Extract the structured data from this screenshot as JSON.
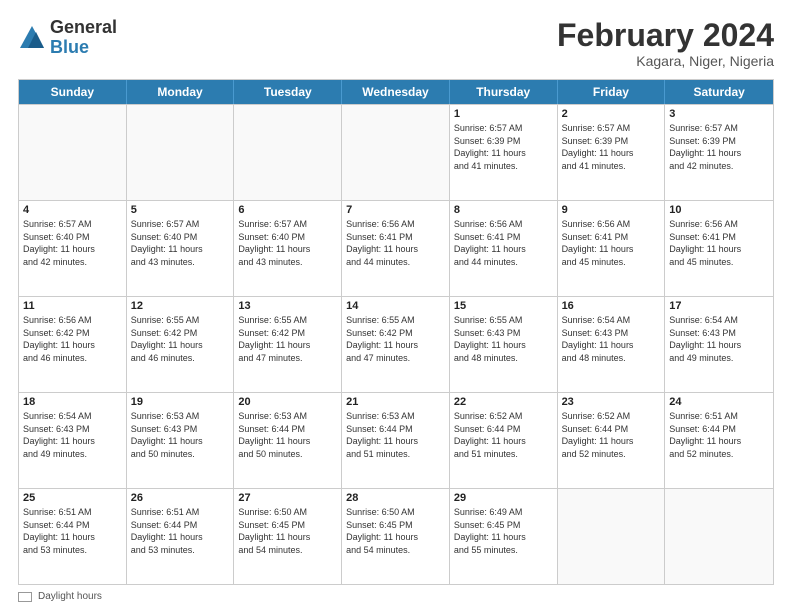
{
  "logo": {
    "general": "General",
    "blue": "Blue"
  },
  "header": {
    "month": "February 2024",
    "location": "Kagara, Niger, Nigeria"
  },
  "weekdays": [
    "Sunday",
    "Monday",
    "Tuesday",
    "Wednesday",
    "Thursday",
    "Friday",
    "Saturday"
  ],
  "footer": {
    "daylight_label": "Daylight hours"
  },
  "weeks": [
    [
      {
        "day": "",
        "info": ""
      },
      {
        "day": "",
        "info": ""
      },
      {
        "day": "",
        "info": ""
      },
      {
        "day": "",
        "info": ""
      },
      {
        "day": "1",
        "info": "Sunrise: 6:57 AM\nSunset: 6:39 PM\nDaylight: 11 hours\nand 41 minutes."
      },
      {
        "day": "2",
        "info": "Sunrise: 6:57 AM\nSunset: 6:39 PM\nDaylight: 11 hours\nand 41 minutes."
      },
      {
        "day": "3",
        "info": "Sunrise: 6:57 AM\nSunset: 6:39 PM\nDaylight: 11 hours\nand 42 minutes."
      }
    ],
    [
      {
        "day": "4",
        "info": "Sunrise: 6:57 AM\nSunset: 6:40 PM\nDaylight: 11 hours\nand 42 minutes."
      },
      {
        "day": "5",
        "info": "Sunrise: 6:57 AM\nSunset: 6:40 PM\nDaylight: 11 hours\nand 43 minutes."
      },
      {
        "day": "6",
        "info": "Sunrise: 6:57 AM\nSunset: 6:40 PM\nDaylight: 11 hours\nand 43 minutes."
      },
      {
        "day": "7",
        "info": "Sunrise: 6:56 AM\nSunset: 6:41 PM\nDaylight: 11 hours\nand 44 minutes."
      },
      {
        "day": "8",
        "info": "Sunrise: 6:56 AM\nSunset: 6:41 PM\nDaylight: 11 hours\nand 44 minutes."
      },
      {
        "day": "9",
        "info": "Sunrise: 6:56 AM\nSunset: 6:41 PM\nDaylight: 11 hours\nand 45 minutes."
      },
      {
        "day": "10",
        "info": "Sunrise: 6:56 AM\nSunset: 6:41 PM\nDaylight: 11 hours\nand 45 minutes."
      }
    ],
    [
      {
        "day": "11",
        "info": "Sunrise: 6:56 AM\nSunset: 6:42 PM\nDaylight: 11 hours\nand 46 minutes."
      },
      {
        "day": "12",
        "info": "Sunrise: 6:55 AM\nSunset: 6:42 PM\nDaylight: 11 hours\nand 46 minutes."
      },
      {
        "day": "13",
        "info": "Sunrise: 6:55 AM\nSunset: 6:42 PM\nDaylight: 11 hours\nand 47 minutes."
      },
      {
        "day": "14",
        "info": "Sunrise: 6:55 AM\nSunset: 6:42 PM\nDaylight: 11 hours\nand 47 minutes."
      },
      {
        "day": "15",
        "info": "Sunrise: 6:55 AM\nSunset: 6:43 PM\nDaylight: 11 hours\nand 48 minutes."
      },
      {
        "day": "16",
        "info": "Sunrise: 6:54 AM\nSunset: 6:43 PM\nDaylight: 11 hours\nand 48 minutes."
      },
      {
        "day": "17",
        "info": "Sunrise: 6:54 AM\nSunset: 6:43 PM\nDaylight: 11 hours\nand 49 minutes."
      }
    ],
    [
      {
        "day": "18",
        "info": "Sunrise: 6:54 AM\nSunset: 6:43 PM\nDaylight: 11 hours\nand 49 minutes."
      },
      {
        "day": "19",
        "info": "Sunrise: 6:53 AM\nSunset: 6:43 PM\nDaylight: 11 hours\nand 50 minutes."
      },
      {
        "day": "20",
        "info": "Sunrise: 6:53 AM\nSunset: 6:44 PM\nDaylight: 11 hours\nand 50 minutes."
      },
      {
        "day": "21",
        "info": "Sunrise: 6:53 AM\nSunset: 6:44 PM\nDaylight: 11 hours\nand 51 minutes."
      },
      {
        "day": "22",
        "info": "Sunrise: 6:52 AM\nSunset: 6:44 PM\nDaylight: 11 hours\nand 51 minutes."
      },
      {
        "day": "23",
        "info": "Sunrise: 6:52 AM\nSunset: 6:44 PM\nDaylight: 11 hours\nand 52 minutes."
      },
      {
        "day": "24",
        "info": "Sunrise: 6:51 AM\nSunset: 6:44 PM\nDaylight: 11 hours\nand 52 minutes."
      }
    ],
    [
      {
        "day": "25",
        "info": "Sunrise: 6:51 AM\nSunset: 6:44 PM\nDaylight: 11 hours\nand 53 minutes."
      },
      {
        "day": "26",
        "info": "Sunrise: 6:51 AM\nSunset: 6:44 PM\nDaylight: 11 hours\nand 53 minutes."
      },
      {
        "day": "27",
        "info": "Sunrise: 6:50 AM\nSunset: 6:45 PM\nDaylight: 11 hours\nand 54 minutes."
      },
      {
        "day": "28",
        "info": "Sunrise: 6:50 AM\nSunset: 6:45 PM\nDaylight: 11 hours\nand 54 minutes."
      },
      {
        "day": "29",
        "info": "Sunrise: 6:49 AM\nSunset: 6:45 PM\nDaylight: 11 hours\nand 55 minutes."
      },
      {
        "day": "",
        "info": ""
      },
      {
        "day": "",
        "info": ""
      }
    ]
  ]
}
